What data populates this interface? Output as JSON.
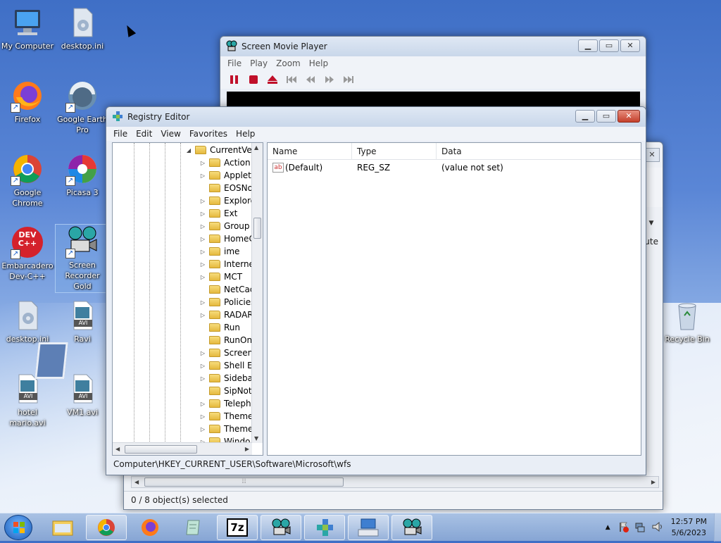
{
  "desktop": {
    "icons": [
      {
        "label": "My Computer",
        "icon": "computer-icon"
      },
      {
        "label": "desktop.ini",
        "icon": "settings-file-icon"
      },
      {
        "label": "Firefox",
        "icon": "firefox-icon"
      },
      {
        "label": "Google Earth Pro",
        "icon": "google-earth-icon",
        "badge": "Pro"
      },
      {
        "label": "Google Chrome",
        "icon": "chrome-icon"
      },
      {
        "label": "Picasa 3",
        "icon": "picasa-icon"
      },
      {
        "label": "Embarcadero Dev-C++",
        "icon": "devcpp-icon",
        "badge": "DEV C++"
      },
      {
        "label": "Screen Recorder Gold",
        "icon": "screen-recorder-icon"
      },
      {
        "label": "desktop.ini",
        "icon": "settings-file-icon"
      },
      {
        "label": "Ravi",
        "icon": "avi-file-icon",
        "badge": "AVI"
      },
      {
        "label": "hotel mario.avi",
        "icon": "avi-file-icon",
        "badge": "AVI"
      },
      {
        "label": "VM1.avi",
        "icon": "avi-file-icon",
        "badge": "AVI"
      },
      {
        "label": "Recycle Bin",
        "icon": "recycle-bin-icon"
      }
    ]
  },
  "movie_player": {
    "title": "Screen Movie Player",
    "menu": [
      "File",
      "Play",
      "Zoom",
      "Help"
    ],
    "controls": [
      "pause-icon",
      "stop-icon",
      "eject-icon",
      "skip-start-icon",
      "rewind-icon",
      "forward-icon",
      "skip-end-icon"
    ],
    "position": 0.92
  },
  "background_window": {
    "status": "0 / 8 object(s) selected",
    "partial_text": "ute"
  },
  "registry": {
    "title": "Registry Editor",
    "menu": [
      "File",
      "Edit",
      "View",
      "Favorites",
      "Help"
    ],
    "tree": {
      "root": "CurrentVer",
      "items": [
        {
          "label": "Action",
          "expandable": true
        },
        {
          "label": "Applets",
          "expandable": true
        },
        {
          "label": "EOSNo",
          "expandable": false
        },
        {
          "label": "Explore",
          "expandable": true
        },
        {
          "label": "Ext",
          "expandable": true
        },
        {
          "label": "Group I",
          "expandable": true
        },
        {
          "label": "HomeC",
          "expandable": true
        },
        {
          "label": "ime",
          "expandable": true
        },
        {
          "label": "Interne",
          "expandable": true
        },
        {
          "label": "MCT",
          "expandable": true
        },
        {
          "label": "NetCac",
          "expandable": false
        },
        {
          "label": "Policies",
          "expandable": true
        },
        {
          "label": "RADAR",
          "expandable": true
        },
        {
          "label": "Run",
          "expandable": false
        },
        {
          "label": "RunOn",
          "expandable": false
        },
        {
          "label": "Screens",
          "expandable": true
        },
        {
          "label": "Shell Ex",
          "expandable": true
        },
        {
          "label": "Sidebar",
          "expandable": true
        },
        {
          "label": "SipNoti",
          "expandable": false
        },
        {
          "label": "Teleph",
          "expandable": true
        },
        {
          "label": "Theme",
          "expandable": true
        },
        {
          "label": "Theme",
          "expandable": true
        },
        {
          "label": "Windo",
          "expandable": true
        }
      ]
    },
    "columns": [
      "Name",
      "Type",
      "Data"
    ],
    "values": [
      {
        "name": "(Default)",
        "type": "REG_SZ",
        "data": "(value not set)",
        "icon": "ab"
      }
    ],
    "status_path": "Computer\\HKEY_CURRENT_USER\\Software\\Microsoft\\wfs"
  },
  "taskbar": {
    "apps": [
      "file-explorer-icon",
      "chrome-icon",
      "firefox-icon",
      "notepad-icon",
      "7zip-icon",
      "screen-recorder-icon",
      "registry-editor-icon",
      "on-screen-keyboard-icon",
      "screen-movie-player-icon"
    ],
    "app_7z_label": "7z",
    "time": "12:57 PM",
    "date": "5/6/2023"
  },
  "colors": {
    "desktop_blue": "#3f6fc6",
    "close_red": "#c4402c",
    "stop_red": "#c0102a"
  }
}
